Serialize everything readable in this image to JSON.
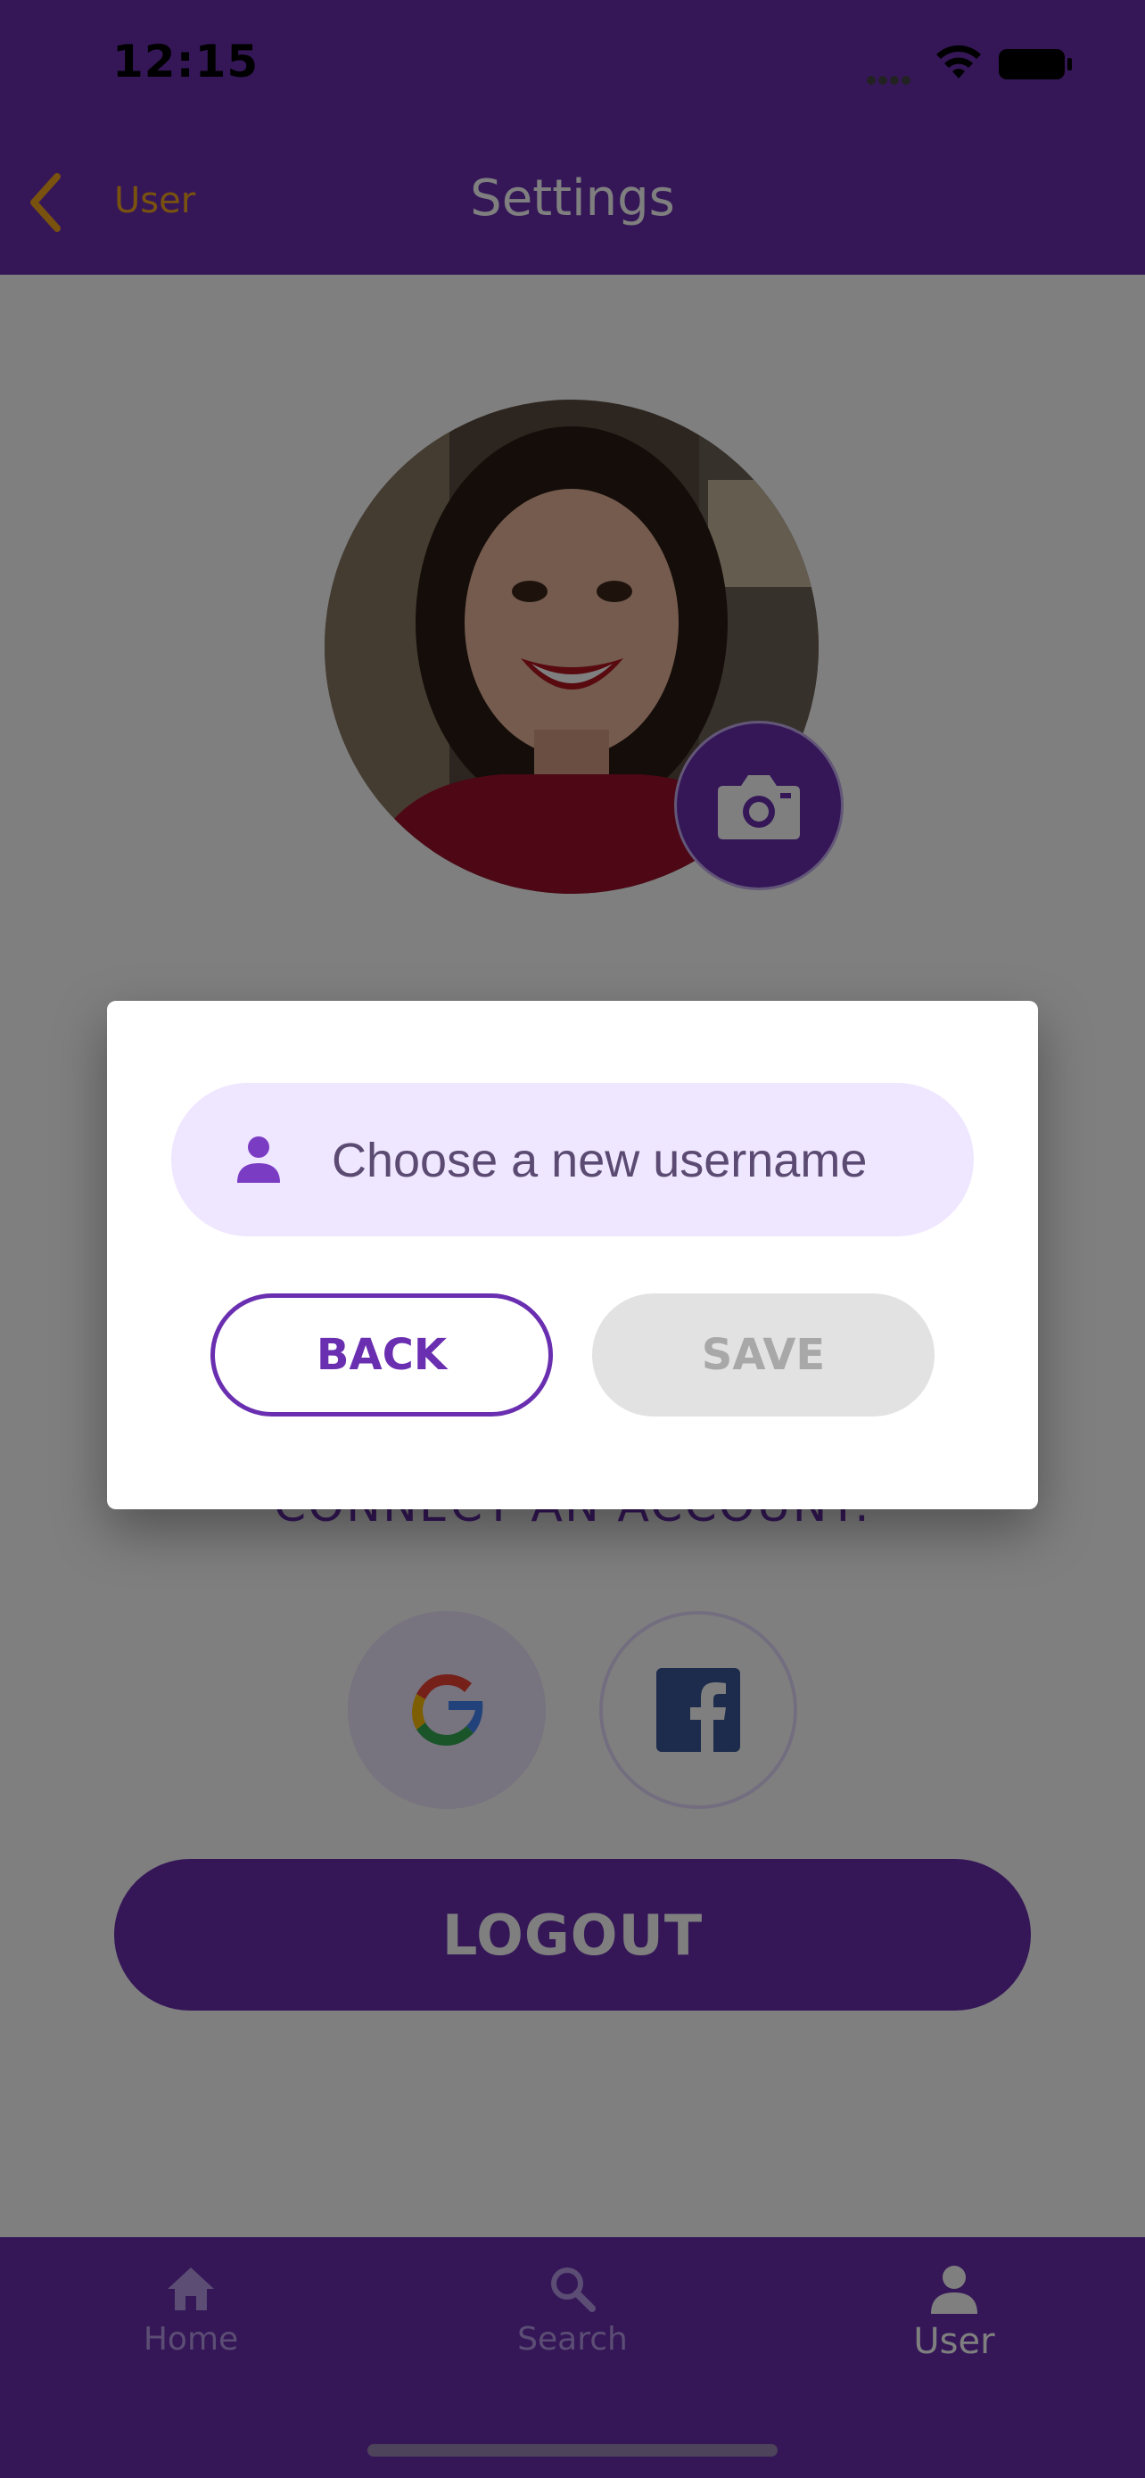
{
  "status_bar": {
    "time": "12:15"
  },
  "nav": {
    "back_label": "User",
    "title": "Settings"
  },
  "profile": {
    "photo_icon": "camera-icon"
  },
  "connect": {
    "label": "CONNECT AN ACCOUNT:",
    "providers": [
      {
        "name": "google",
        "icon": "google-icon"
      },
      {
        "name": "facebook",
        "icon": "facebook-icon"
      }
    ]
  },
  "logout_label": "LOGOUT",
  "tabs": [
    {
      "label": "Home",
      "icon": "home-icon",
      "active": false
    },
    {
      "label": "Search",
      "icon": "search-icon",
      "active": false
    },
    {
      "label": "User",
      "icon": "user-icon",
      "active": true
    }
  ],
  "dialog": {
    "username_placeholder": "Choose a new username",
    "back_label": "BACK",
    "save_label": "SAVE"
  },
  "colors": {
    "primary": "#6a2fb0",
    "accent": "#f2a51e",
    "field_bg": "#efe6ff",
    "disabled": "#e2e2e2"
  }
}
